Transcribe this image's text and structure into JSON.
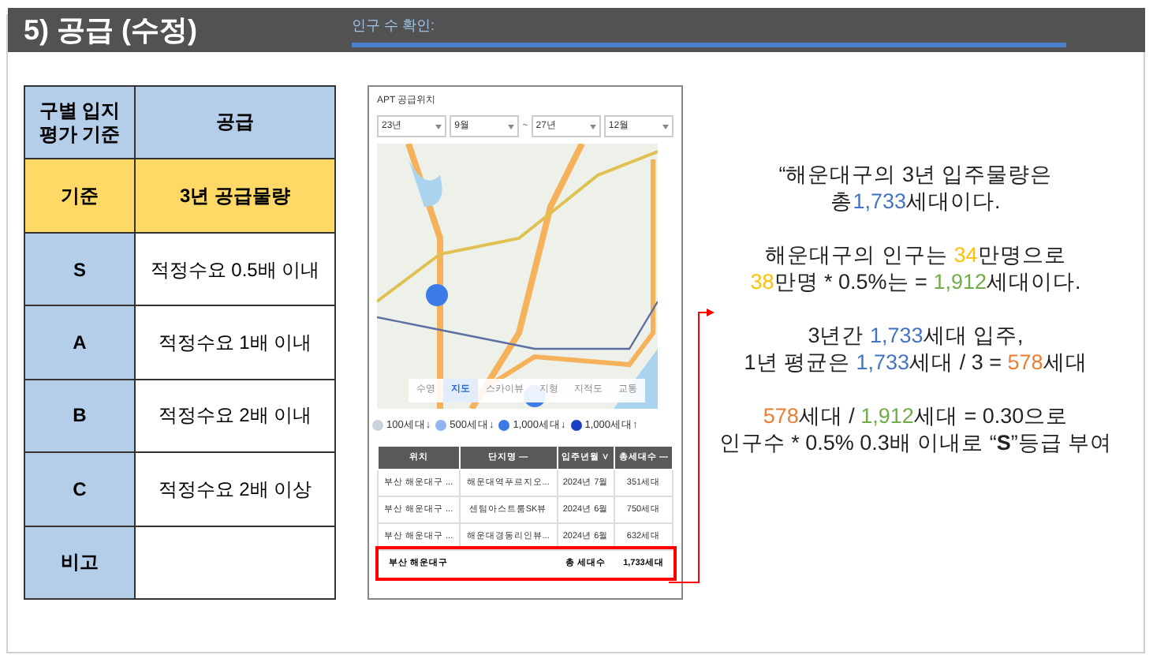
{
  "header": {
    "title": "5) 공급 (수정)",
    "note": "인구 수 확인:"
  },
  "criteria_table": {
    "columns": [
      "구별 입지 평가 기준",
      "공급"
    ],
    "rows": [
      {
        "kind": "highlight",
        "label": "기준",
        "value": "3년 공급물량"
      },
      {
        "kind": "normal",
        "label": "S",
        "value": "적정수요 0.5배 이내"
      },
      {
        "kind": "normal",
        "label": "A",
        "value": "적정수요 1배 이내"
      },
      {
        "kind": "normal",
        "label": "B",
        "value": "적정수요 2배 이내"
      },
      {
        "kind": "normal",
        "label": "C",
        "value": "적정수요 2배 이상"
      },
      {
        "kind": "normal",
        "label": "비고",
        "value": ""
      }
    ]
  },
  "apt_panel": {
    "title": "APT 공급위치",
    "filters": [
      {
        "value": "23년"
      },
      {
        "value": "9월"
      },
      {
        "separator": "~",
        "value": "27년"
      },
      {
        "value": "12월"
      }
    ],
    "map_tabs": [
      {
        "label": "수영",
        "selected": false
      },
      {
        "label": "지도",
        "selected": true
      },
      {
        "label": "스카이뷰",
        "selected": false
      },
      {
        "label": "지형",
        "selected": false
      },
      {
        "label": "지적도",
        "selected": false
      },
      {
        "label": "교통",
        "selected": false
      }
    ],
    "legend": [
      {
        "label": "100세대↓",
        "color": "#c9d3e0"
      },
      {
        "label": "500세대↓",
        "color": "#8fb4f0"
      },
      {
        "label": "1,000세대↓",
        "color": "#3d7be6"
      },
      {
        "label": "1,000세대↑",
        "color": "#1a3fc4"
      }
    ],
    "table": {
      "columns": [
        "위치",
        "단지명 —",
        "입주년월 ∨",
        "총세대수 —"
      ],
      "rows": [
        [
          "부산 해운대구 ...",
          "해운대역푸르지오...",
          "2024년 7월",
          "351세대"
        ],
        [
          "부산 해운대구 ...",
          "센텀아스트룸SK뷰",
          "2024년 6월",
          "750세대"
        ],
        [
          "부산 해운대구 ...",
          "해운대경동리인뷰...",
          "2024년 6월",
          "632세대"
        ]
      ],
      "total": {
        "location": "부산 해운대구",
        "label": "총 세대수",
        "value": "1,733세대"
      }
    }
  },
  "explanation": [
    {
      "lines": [
        [
          {
            "text": "“해운대구의 3년 입주물량은"
          }
        ],
        [
          {
            "text": "총"
          },
          {
            "text": "1,733",
            "color": "#4472c4"
          },
          {
            "text": "세대이다."
          }
        ]
      ]
    },
    {
      "lines": [
        [
          {
            "text": "해운대구의 인구는 "
          },
          {
            "text": "34",
            "color": "#ffc000"
          },
          {
            "text": "만명으로"
          }
        ],
        [
          {
            "text": "38",
            "color": "#ffc000"
          },
          {
            "text": "만명 * 0.5%는 = "
          },
          {
            "text": "1,912",
            "color": "#70ad47"
          },
          {
            "text": "세대이다."
          }
        ]
      ]
    },
    {
      "lines": [
        [
          {
            "text": "3년간 "
          },
          {
            "text": "1,733",
            "color": "#4472c4"
          },
          {
            "text": "세대 입주,"
          }
        ],
        [
          {
            "text": "1년 평균은 "
          },
          {
            "text": "1,733",
            "color": "#4472c4"
          },
          {
            "text": "세대 / 3 = "
          },
          {
            "text": "578",
            "color": "#ed7d31"
          },
          {
            "text": "세대"
          }
        ]
      ]
    },
    {
      "lines": [
        [
          {
            "text": "578",
            "color": "#ed7d31"
          },
          {
            "text": "세대 / "
          },
          {
            "text": "1,912",
            "color": "#70ad47"
          },
          {
            "text": "세대 = 0.30으로"
          }
        ],
        [
          {
            "text": "인구수 * 0.5% 0.3배 이내로 “**S**”등급 부여"
          }
        ]
      ]
    }
  ]
}
